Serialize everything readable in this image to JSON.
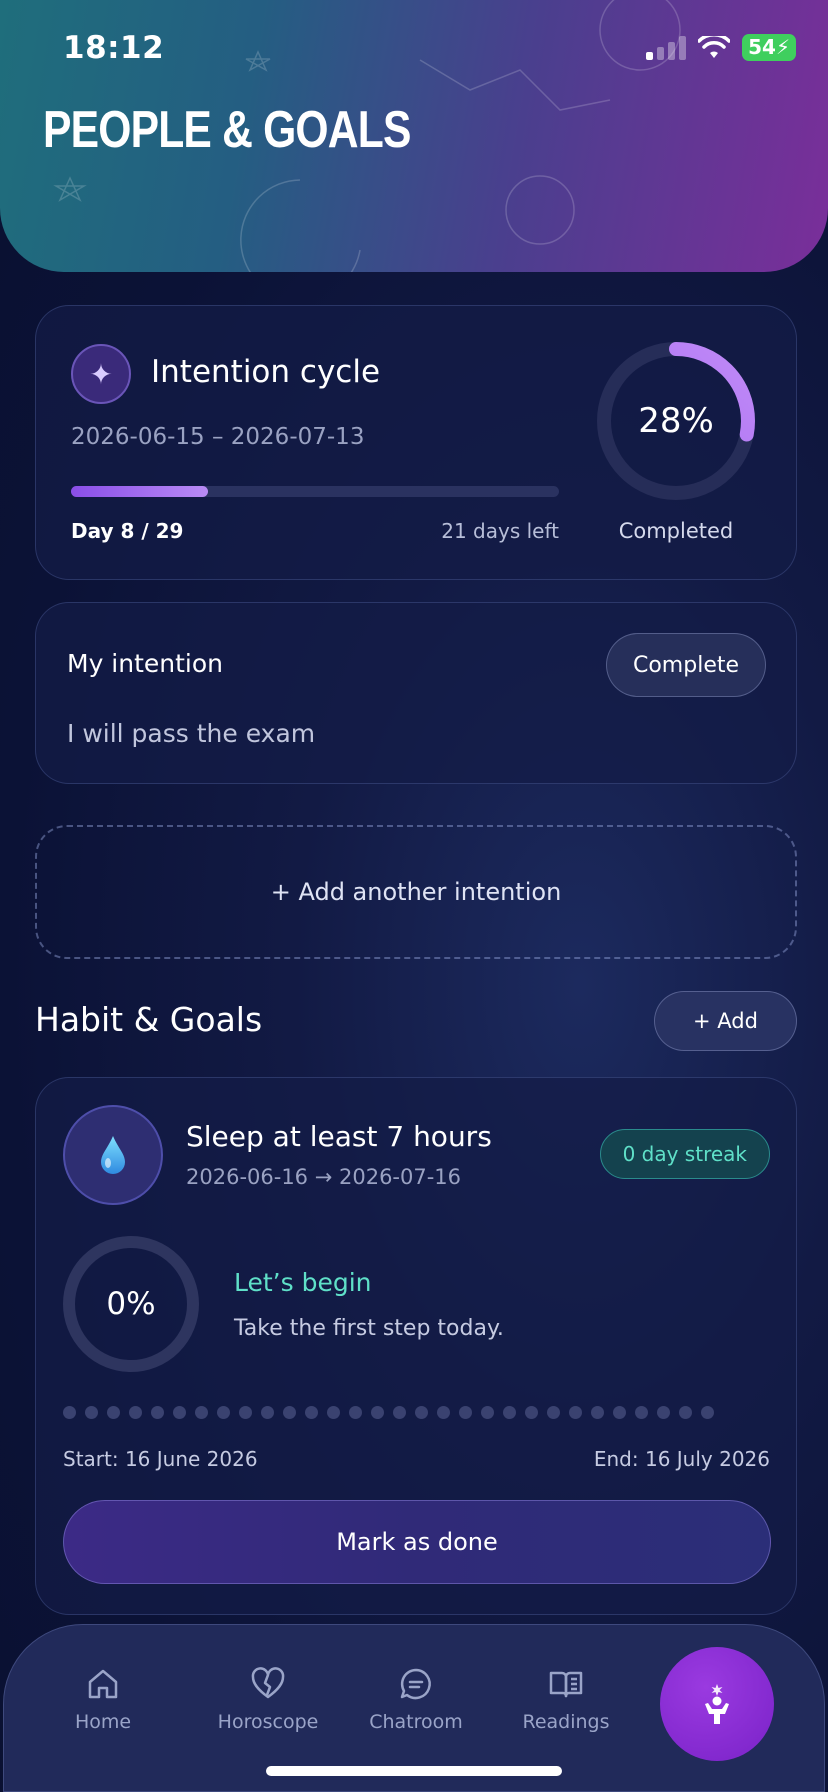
{
  "status_bar": {
    "time": "18:12",
    "battery": "54"
  },
  "header": {
    "title": "PEOPLE & GOALS"
  },
  "intention_cycle": {
    "title": "Intention cycle",
    "dates": "2026-06-15 – 2026-07-13",
    "progress_fraction": 0.28,
    "day_label": "Day 8 / 29",
    "days_left": "21 days left",
    "percent": "28%",
    "completed_label": "Completed"
  },
  "my_intention": {
    "title": "My intention",
    "text": "I will pass the exam",
    "complete_label": "Complete"
  },
  "add_intention_label": "+ Add another intention",
  "habits_section": {
    "title": "Habit & Goals",
    "add_label": "+ Add"
  },
  "habit": {
    "title": "Sleep at least 7 hours",
    "dates": "2026-06-16 → 2026-07-16",
    "streak": "0 day streak",
    "percent": "0%",
    "progress_fraction": 0,
    "begin_title": "Let’s begin",
    "begin_subtitle": "Take the first step today.",
    "day_count": 30,
    "start_label": "Start: 16 June 2026",
    "end_label": "End: 16 July 2026",
    "mark_done_label": "Mark as done"
  },
  "nav": {
    "items": [
      {
        "label": "Home",
        "icon": "home-icon"
      },
      {
        "label": "Horoscope",
        "icon": "heart-icon"
      },
      {
        "label": "Chatroom",
        "icon": "chat-icon"
      },
      {
        "label": "Readings",
        "icon": "book-icon"
      }
    ],
    "fab_icon": "meditation-icon"
  },
  "colors": {
    "accent_purple": "#9a5cf0",
    "accent_teal": "#5fe0c8",
    "battery_green": "#3fcf5e"
  }
}
